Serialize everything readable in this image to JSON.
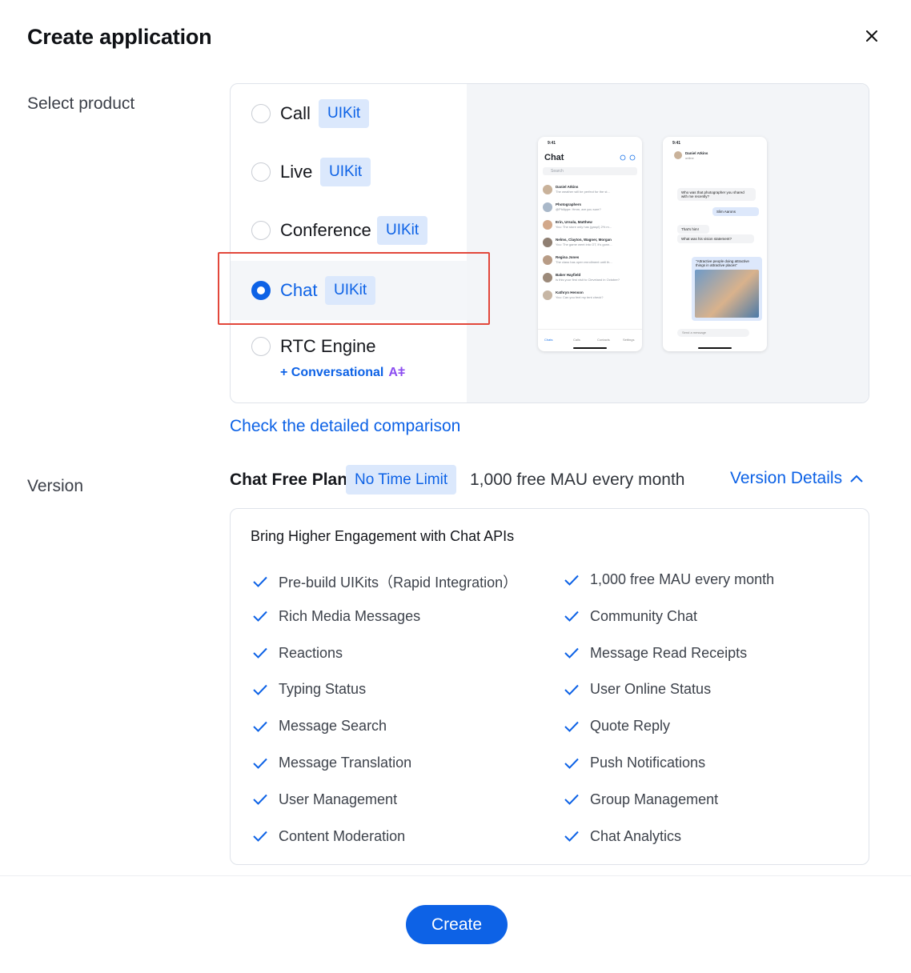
{
  "dialog": {
    "title": "Create application"
  },
  "select_product": {
    "label": "Select product",
    "products": [
      {
        "name": "Call",
        "badge": "UIKit",
        "selected": false
      },
      {
        "name": "Live",
        "badge": "UIKit",
        "selected": false
      },
      {
        "name": "Conference",
        "badge": "UIKit",
        "selected": false
      },
      {
        "name": "Chat",
        "badge": "UIKit",
        "selected": true
      },
      {
        "name": "RTC Engine",
        "badge": "",
        "selected": false
      }
    ],
    "conversational_label": "+ Conversational",
    "conversational_ai": "Aǂ",
    "compare_link": "Check the detailed comparison"
  },
  "preview": {
    "list_phone": {
      "time": "9:41",
      "title": "Chat",
      "search": "Search",
      "rows": [
        {
          "name": "Daniel Atkins",
          "msg": "The weather will be perfect for the st..."
        },
        {
          "name": "Photographers",
          "msg": "@Philippe: Hmm, are you sure?"
        },
        {
          "name": "Erin, Ursula, Matthew",
          "msg": "You: The store only has (gasp!) 2% m..."
        },
        {
          "name": "Nelms, Clayton, Wagner, Morgan",
          "msg": "You: The game went into OT, it's gonn..."
        },
        {
          "name": "Regina Jones",
          "msg": "The class has open enrollment until th..."
        },
        {
          "name": "Baker Hayfield",
          "msg": "Is this your first visit to Cleveland in October?"
        },
        {
          "name": "Kathryn Henson",
          "msg": "You: Can you feel my tent check?"
        }
      ],
      "tabs": [
        "Chats",
        "Calls",
        "Contacts",
        "Settings"
      ]
    },
    "chat_phone": {
      "time": "9:41",
      "contact": "Daniel Atkins",
      "status": "online",
      "messages": [
        "Who was that photographer you shared with me recently?",
        "Slim Aarons",
        "That's him!",
        "What was his vision statement?",
        "\"Attractive people doing attractive things in attractive places\""
      ],
      "input_placeholder": "Send a message"
    }
  },
  "version": {
    "label": "Version",
    "plan_name": "Chat Free Plan",
    "plan_badge": "No Time Limit",
    "plan_summary": "1,000 free MAU every month",
    "details_link": "Version Details",
    "features_heading": "Bring Higher Engagement with Chat APIs",
    "features_left": [
      "Pre-build UIKits（Rapid Integration）",
      "Rich Media Messages",
      "Reactions",
      "Typing Status",
      "Message Search",
      "Message Translation",
      "User Management",
      "Content Moderation"
    ],
    "features_right": [
      "1,000 free MAU every month",
      "Community Chat",
      "Message Read Receipts",
      "User Online Status",
      "Quote Reply",
      "Push Notifications",
      "Group Management",
      "Chat Analytics"
    ]
  },
  "footer": {
    "create_label": "Create"
  },
  "colors": {
    "accent": "#0d62e6",
    "highlight": "#e2473b",
    "badge_bg": "#dbe8fc"
  }
}
